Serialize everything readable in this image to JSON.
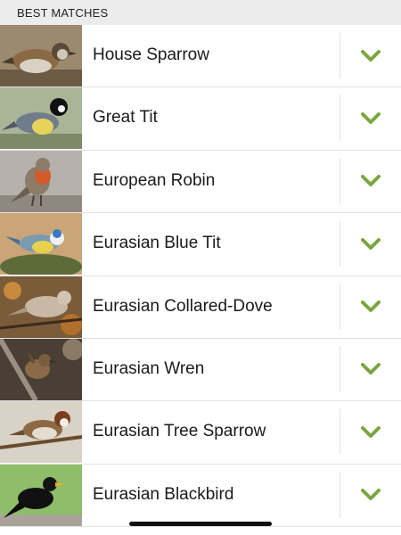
{
  "section": {
    "title": "BEST MATCHES"
  },
  "colors": {
    "accent": "#7aa640",
    "header_bg": "#ececec",
    "divider": "#e3e3e3"
  },
  "results": [
    {
      "name": "House Sparrow",
      "icon": "chevron-down-icon"
    },
    {
      "name": "Great Tit",
      "icon": "chevron-down-icon"
    },
    {
      "name": "European Robin",
      "icon": "chevron-down-icon"
    },
    {
      "name": "Eurasian Blue Tit",
      "icon": "chevron-down-icon"
    },
    {
      "name": "Eurasian Collared-Dove",
      "icon": "chevron-down-icon"
    },
    {
      "name": "Eurasian Wren",
      "icon": "chevron-down-icon"
    },
    {
      "name": "Eurasian Tree Sparrow",
      "icon": "chevron-down-icon"
    },
    {
      "name": "Eurasian Blackbird",
      "icon": "chevron-down-icon"
    }
  ]
}
